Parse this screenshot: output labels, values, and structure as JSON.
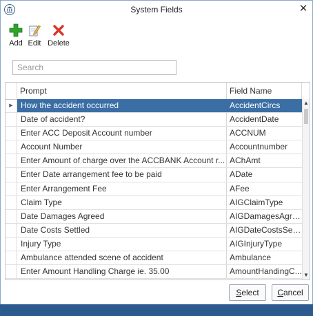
{
  "window": {
    "title": "System Fields"
  },
  "icons": {
    "app": "building-icon",
    "close": "close-icon",
    "add": "plus-icon",
    "edit": "edit-pencil-icon",
    "delete": "red-x-icon"
  },
  "colors": {
    "selection": "#3a6ea5",
    "footer": "#2c5a8f",
    "add_green": "#2da32d",
    "delete_red": "#d9342b"
  },
  "toolbar": {
    "add_label": "Add",
    "edit_label": "Edit",
    "delete_label": "Delete"
  },
  "search": {
    "placeholder": "Search",
    "value": ""
  },
  "grid": {
    "columns": [
      "Prompt",
      "Field Name"
    ],
    "rows": [
      {
        "prompt": "How the accident occurred",
        "field": "AccidentCircs",
        "selected": true
      },
      {
        "prompt": "Date of accident?",
        "field": "AccidentDate"
      },
      {
        "prompt": "Enter ACC Deposit Account number",
        "field": "ACCNUM"
      },
      {
        "prompt": "Account Number",
        "field": "Accountnumber"
      },
      {
        "prompt": "Enter Amount of charge over the ACCBANK Account r...",
        "field": "AChAmt"
      },
      {
        "prompt": "Enter Date arrangement fee to be paid",
        "field": "ADate"
      },
      {
        "prompt": "Enter Arrangement Fee",
        "field": "AFee"
      },
      {
        "prompt": "Claim Type",
        "field": "AIGClaimType"
      },
      {
        "prompt": "Date Damages Agreed",
        "field": "AIGDamagesAgreed"
      },
      {
        "prompt": "Date Costs Settled",
        "field": "AIGDateCostsSettl..."
      },
      {
        "prompt": "Injury Type",
        "field": "AIGInjuryType"
      },
      {
        "prompt": "Ambulance attended scene of accident",
        "field": "Ambulance"
      },
      {
        "prompt": "Enter Amount Handling Charge ie. 35.00",
        "field": "AmountHandingC..."
      }
    ]
  },
  "buttons": {
    "select_label_mnemonic": "S",
    "select_label_rest": "elect",
    "cancel_label_mnemonic": "C",
    "cancel_label_rest": "ancel"
  }
}
